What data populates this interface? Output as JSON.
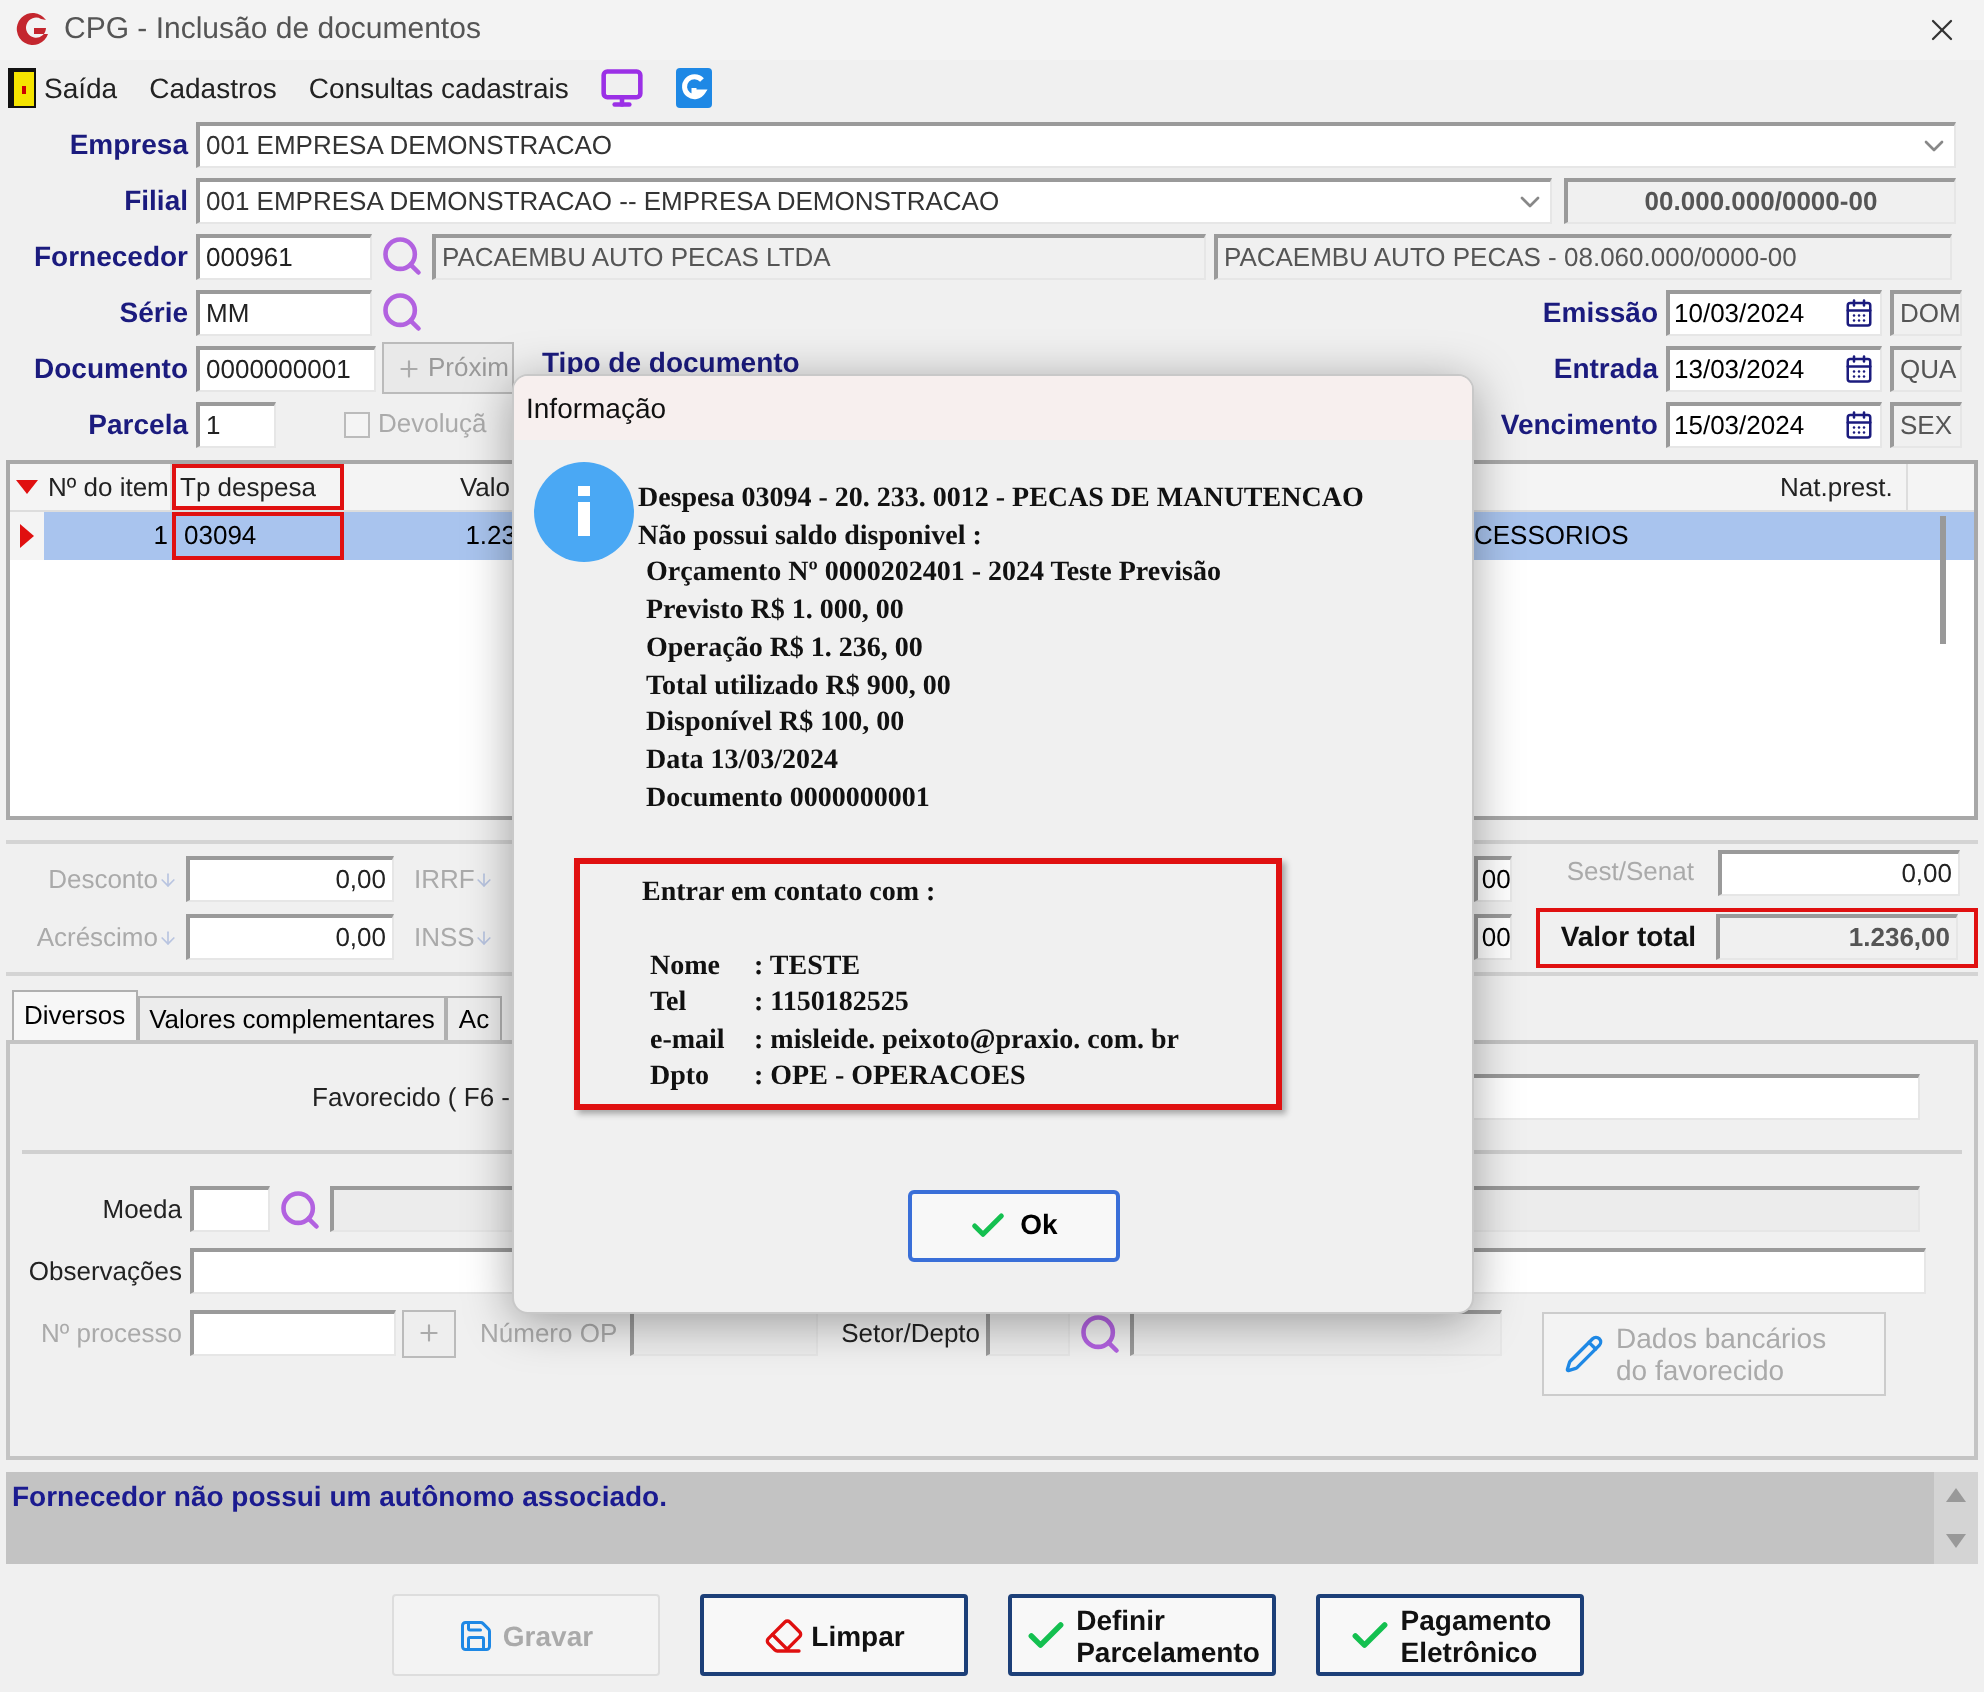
{
  "window": {
    "title": "CPG - Inclusão de documentos"
  },
  "menu": [
    {
      "label": "Saída",
      "kind": "exit"
    },
    {
      "label": "Cadastros",
      "kind": "text"
    },
    {
      "label": "Consultas cadastrais",
      "kind": "text"
    }
  ],
  "form": {
    "empresa": {
      "label": "Empresa",
      "value": "001 EMPRESA DEMONSTRACAO"
    },
    "filial": {
      "label": "Filial",
      "value": "001 EMPRESA DEMONSTRACAO -- EMPRESA DEMONSTRACAO",
      "cnpj": "00.000.000/0000-00"
    },
    "fornecedor": {
      "label": "Fornecedor",
      "code": "000961",
      "name": "PACAEMBU AUTO PECAS LTDA",
      "description": "PACAEMBU AUTO PECAS - 08.060.000/0000-00"
    },
    "serie": {
      "label": "Série",
      "value": "MM"
    },
    "documento": {
      "label": "Documento",
      "value": "0000000001",
      "next_button": "Próxim",
      "type_label": "Tipo de documento"
    },
    "parcela": {
      "label": "Parcela",
      "value": "1",
      "devolucao": {
        "label": "Devoluçã",
        "checked": false
      }
    },
    "dates": [
      {
        "label": "Emissão",
        "value": "10/03/2024",
        "weekday": "DOM"
      },
      {
        "label": "Entrada",
        "value": "13/03/2024",
        "weekday": "QUA"
      },
      {
        "label": "Vencimento",
        "value": "15/03/2024",
        "weekday": "SEX"
      }
    ]
  },
  "grid": {
    "columns": [
      {
        "label": "Nº do item",
        "highlighted": false
      },
      {
        "label": "Tp despesa",
        "highlighted": true
      },
      {
        "label": "Valo",
        "highlighted": false
      },
      {
        "label": "Nat.prest.",
        "highlighted": false
      }
    ],
    "rows": [
      {
        "selected": true,
        "item": "1",
        "tp_despesa": "03094",
        "valor": "1.23",
        "column_4": "CESSORIOS"
      }
    ]
  },
  "totals": {
    "left": [
      {
        "label": "Desconto",
        "value": "0,00",
        "tax_label": "IRRF"
      },
      {
        "label": "Acréscimo",
        "value": "0,00",
        "tax_label": "INSS"
      }
    ],
    "partial_values": [
      "00",
      "00"
    ],
    "sest_senat": {
      "label": "Sest/Senat",
      "value": "0,00"
    },
    "valor_total": {
      "label": "Valor total",
      "value": "1.236,00",
      "highlighted": true
    }
  },
  "tabs": [
    {
      "label": "Diversos",
      "selected": true
    },
    {
      "label": "Valores complementares",
      "selected": false
    },
    {
      "label": "Ac",
      "selected": false
    }
  ],
  "tab_panel": {
    "favorecido_label": "Favorecido ( F6 -",
    "moeda_label": "Moeda",
    "observacoes_label": "Observações",
    "processo_label": "Nº processo",
    "numero_op_label": "Número OP",
    "setor_label": "Setor/Depto",
    "bank_button": {
      "lines": [
        "Dados bancários",
        "do favorecido"
      ],
      "disabled": true
    }
  },
  "status": "Fornecedor não possui um autônomo associado.",
  "buttons": [
    {
      "kind": "save",
      "lines": [
        "Gravar"
      ],
      "disabled": true
    },
    {
      "kind": "clear",
      "lines": [
        "Limpar"
      ],
      "disabled": false
    },
    {
      "kind": "check",
      "lines": [
        "Definir",
        "Parcelamento"
      ],
      "disabled": false
    },
    {
      "kind": "check",
      "lines": [
        "Pagamento",
        "Eletrônico"
      ],
      "disabled": false
    }
  ],
  "dialog": {
    "title": "Informação",
    "lines": [
      {
        "text": "Despesa 03094 - 20. 233. 0012 - PECAS DE MANUTENCAO",
        "indent": false
      },
      {
        "text": "Não possui saldo disponivel :",
        "indent": false
      },
      {
        "text": "Orçamento Nº 0000202401 - 2024 Teste Previsão",
        "indent": true
      },
      {
        "text": "Previsto R$ 1. 000, 00",
        "indent": true
      },
      {
        "text": "Operação R$ 1. 236, 00",
        "indent": true
      },
      {
        "text": "Total utilizado R$ 900, 00",
        "indent": true
      },
      {
        "text": "Disponível R$ 100, 00",
        "indent": true
      },
      {
        "text": "Data 13/03/2024",
        "indent": true
      },
      {
        "text": "Documento 0000000001",
        "indent": true
      }
    ],
    "contact": {
      "highlighted": true,
      "heading": "Entrar em contato com :",
      "fields": [
        {
          "label": "Nome",
          "value": ": TESTE"
        },
        {
          "label": "Tel",
          "value": ": 1150182525"
        },
        {
          "label": "e-mail",
          "value": ": misleide. peixoto@praxio. com. br"
        },
        {
          "label": "Dpto",
          "value": ": OPE - OPERACOES"
        }
      ]
    },
    "ok_button": "Ok"
  }
}
